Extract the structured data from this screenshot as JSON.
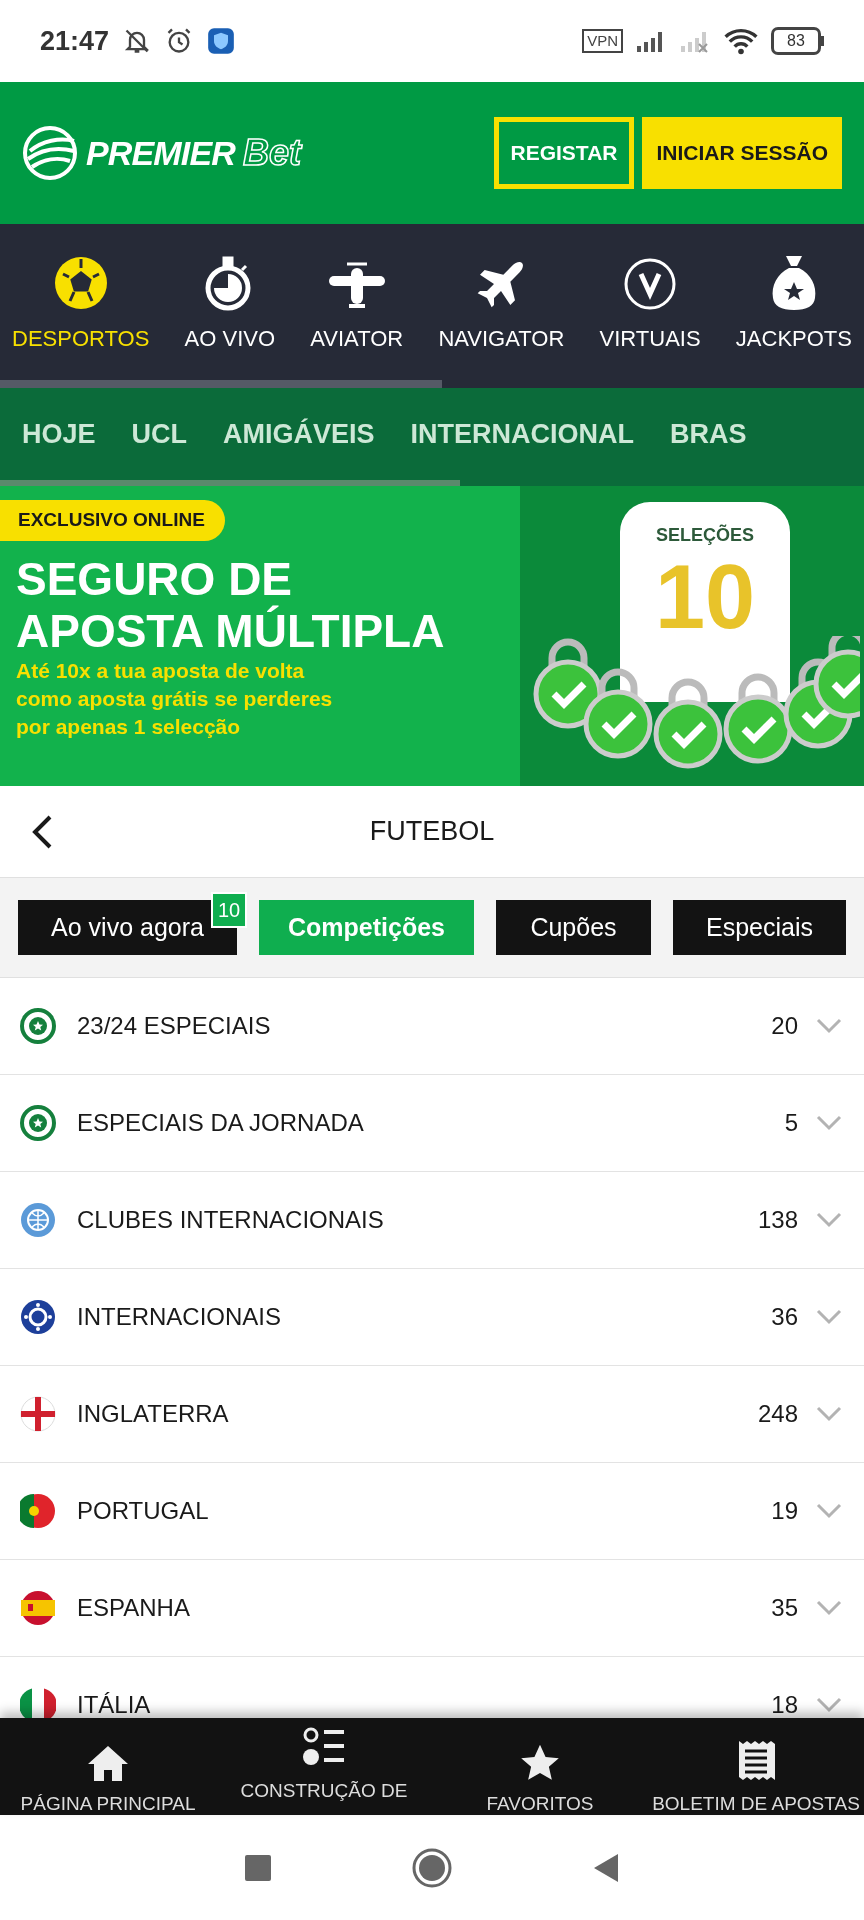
{
  "status_bar": {
    "time": "21:47",
    "vpn": "VPN",
    "battery": "83"
  },
  "header": {
    "logo_main": "PREMIER",
    "logo_accent": "Bet",
    "buttons": [
      {
        "label": "REGISTAR",
        "kind": "outline"
      },
      {
        "label": "INICIAR SESSÃO",
        "kind": "filled"
      }
    ]
  },
  "nav": [
    {
      "label": "DESPORTOS",
      "kind": "ball",
      "selected": true
    },
    {
      "label": "AO VIVO",
      "kind": "stopwatch",
      "selected": false
    },
    {
      "label": "AVIATOR",
      "kind": "plane",
      "selected": false
    },
    {
      "label": "NAVIGATOR",
      "kind": "jet",
      "selected": false
    },
    {
      "label": "VIRTUAIS",
      "kind": "v",
      "selected": false
    },
    {
      "label": "JACKPOTS",
      "kind": "bag",
      "selected": false
    }
  ],
  "subnav": [
    "HOJE",
    "UCL",
    "AMIGÁVEIS",
    "INTERNACIONAL",
    "BRAS"
  ],
  "banner": {
    "tag": "EXCLUSIVO ONLINE",
    "title_lines": [
      "SEGURO DE",
      "APOSTA MÚLTIPLA"
    ],
    "subtitle_lines": [
      "Até 10x a tua aposta de volta",
      "como aposta grátis se perderes",
      "por apenas 1 selecção"
    ],
    "jersey_name": "SELEÇÕES",
    "jersey_number": "10"
  },
  "page_title": "FUTEBOL",
  "tabs": [
    {
      "label": "Ao vivo agora",
      "badge": "10",
      "selected": false
    },
    {
      "label": "Competições",
      "selected": true
    },
    {
      "label": "Cupões",
      "selected": false
    },
    {
      "label": "Especiais",
      "selected": false
    }
  ],
  "competitions": [
    {
      "name": "23/24 ESPECIAIS",
      "count": "20",
      "kind": "star"
    },
    {
      "name": "ESPECIAIS DA JORNADA",
      "count": "5",
      "kind": "star"
    },
    {
      "name": "CLUBES INTERNACIONAIS",
      "count": "138",
      "kind": "globe"
    },
    {
      "name": "INTERNACIONAIS",
      "count": "36",
      "kind": "intl"
    },
    {
      "name": "INGLATERRA",
      "count": "248",
      "kind": "england"
    },
    {
      "name": "PORTUGAL",
      "count": "19",
      "kind": "portugal"
    },
    {
      "name": "ESPANHA",
      "count": "35",
      "kind": "spain"
    },
    {
      "name": "ITÁLIA",
      "count": "18",
      "kind": "italy"
    }
  ],
  "bottom_nav": [
    {
      "label": "PÁGINA PRINCIPAL",
      "kind": "home"
    },
    {
      "label": "CONSTRUÇÃO DE",
      "kind": "builder"
    },
    {
      "label": "FAVORITOS",
      "kind": "star"
    },
    {
      "label": "BOLETIM DE APOSTAS",
      "kind": "slip"
    }
  ]
}
